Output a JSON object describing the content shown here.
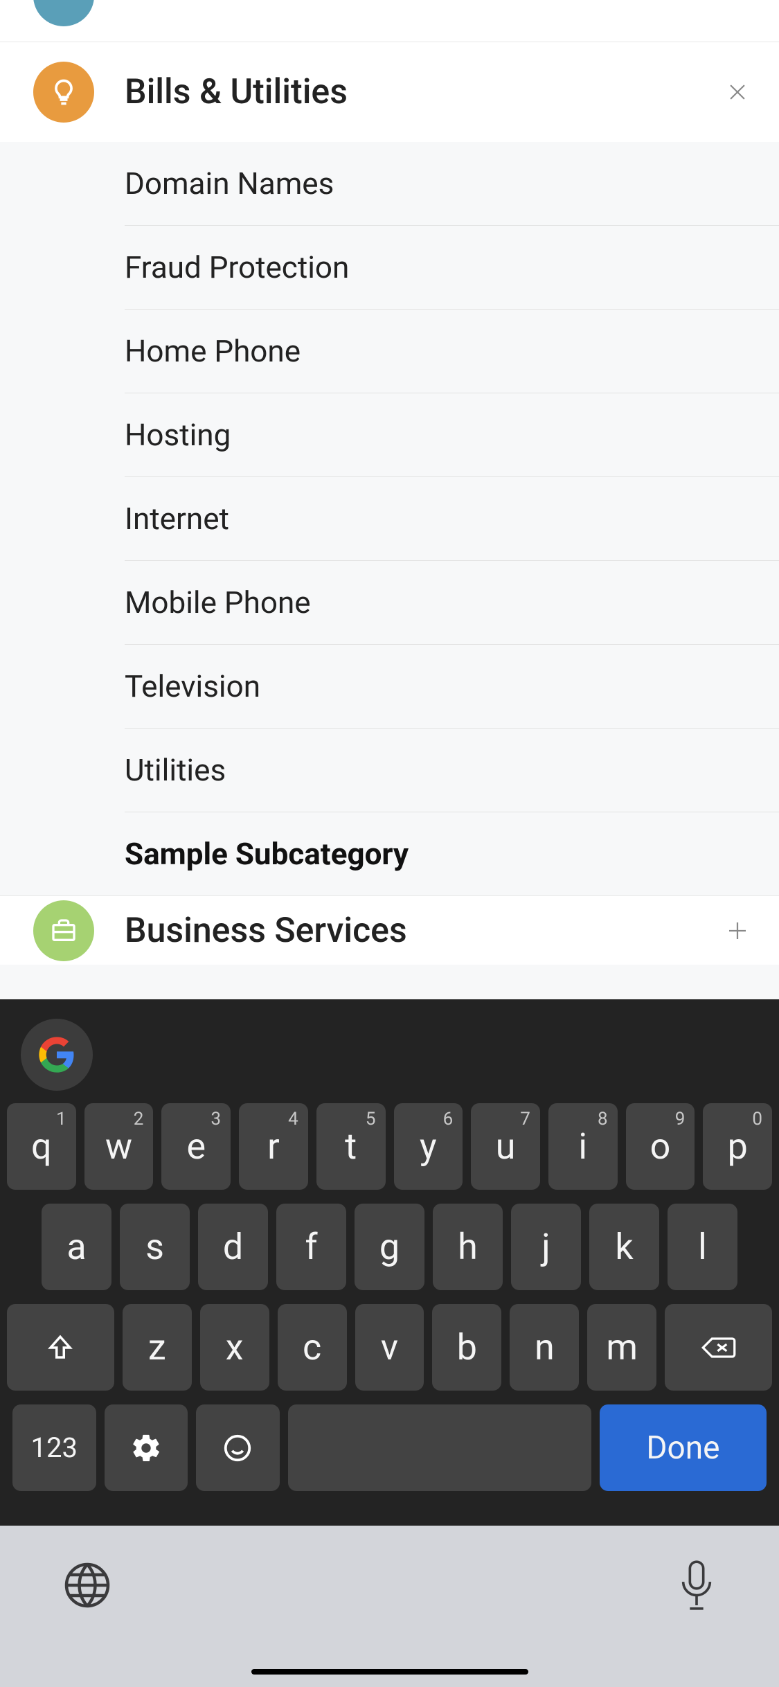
{
  "top_category_color": "#5a9fb8",
  "category": {
    "title": "Bills & Utilities",
    "icon": "lightbulb",
    "items": [
      "Domain Names",
      "Fraud Protection",
      "Home Phone",
      "Hosting",
      "Internet",
      "Mobile Phone",
      "Television",
      "Utilities"
    ],
    "input_value": "Sample Subcategory"
  },
  "next_category": {
    "title": "Business Services",
    "icon": "briefcase"
  },
  "keyboard": {
    "row1": [
      {
        "k": "q",
        "h": "1"
      },
      {
        "k": "w",
        "h": "2"
      },
      {
        "k": "e",
        "h": "3"
      },
      {
        "k": "r",
        "h": "4"
      },
      {
        "k": "t",
        "h": "5"
      },
      {
        "k": "y",
        "h": "6"
      },
      {
        "k": "u",
        "h": "7"
      },
      {
        "k": "i",
        "h": "8"
      },
      {
        "k": "o",
        "h": "9"
      },
      {
        "k": "p",
        "h": "0"
      }
    ],
    "row2": [
      "a",
      "s",
      "d",
      "f",
      "g",
      "h",
      "j",
      "k",
      "l"
    ],
    "row3": [
      "z",
      "x",
      "c",
      "v",
      "b",
      "n",
      "m"
    ],
    "numbers_label": "123",
    "done_label": "Done"
  }
}
